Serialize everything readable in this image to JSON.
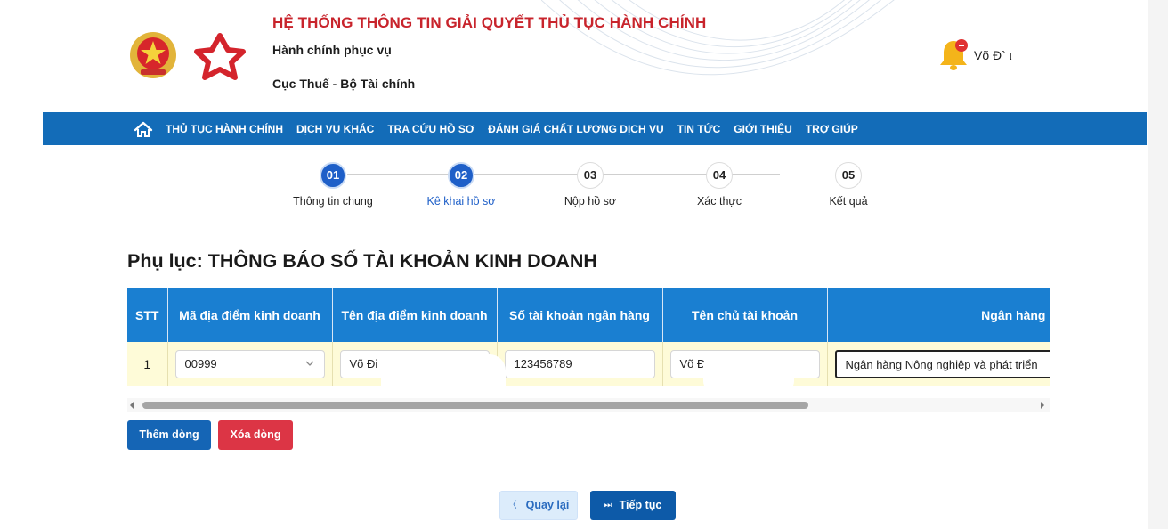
{
  "header": {
    "system_title": "HỆ THỐNG THÔNG TIN GIẢI QUYẾT THỦ TỤC HÀNH CHÍNH",
    "subtitle1": "Hành chính phục vụ",
    "subtitle2": "Cục Thuế - Bộ Tài chính",
    "user_name": "Võ Đ` ι"
  },
  "nav": {
    "items": [
      "THỦ TỤC HÀNH CHÍNH",
      "DỊCH VỤ KHÁC",
      "TRA CỨU HỒ SƠ",
      "ĐÁNH GIÁ CHẤT LƯỢNG DỊCH VỤ",
      "TIN TỨC",
      "GIỚI THIỆU",
      "TRỢ GIÚP"
    ]
  },
  "stepper": {
    "steps": [
      {
        "number": "01",
        "label": "Thông tin chung",
        "state": "done"
      },
      {
        "number": "02",
        "label": "Kê khai hồ sơ",
        "state": "active"
      },
      {
        "number": "03",
        "label": "Nộp hồ sơ",
        "state": "pending"
      },
      {
        "number": "04",
        "label": "Xác thực",
        "state": "pending"
      },
      {
        "number": "05",
        "label": "Kết quả",
        "state": "pending"
      }
    ]
  },
  "page_title": "Phụ lục: THÔNG BÁO SỐ TÀI KHOẢN KINH DOANH",
  "table": {
    "headers": [
      "STT",
      "Mã địa điểm kinh doanh",
      "Tên địa điểm kinh doanh",
      "Số tài khoản ngân hàng",
      "Tên chủ tài khoản",
      "Ngân hàng"
    ],
    "row": {
      "stt": "1",
      "ma_dia_diem": "00999",
      "ten_dia_diem": "Võ Đi",
      "so_tai_khoan": "123456789",
      "ten_chu_tk": "Võ Đ",
      "ngan_hang": "Ngân hàng Nông nghiệp và phát triển"
    }
  },
  "buttons": {
    "add_row": "Thêm dòng",
    "delete_row": "Xóa dòng",
    "back": "Quay lại",
    "next": "Tiếp tục"
  },
  "colors": {
    "nav_bg": "#136cb8",
    "table_header_bg": "#1a7fd1",
    "row_bg": "#fefbd8",
    "title_red": "#c8242c",
    "step_active": "#1e5fc8",
    "delete_red": "#dc3545"
  }
}
